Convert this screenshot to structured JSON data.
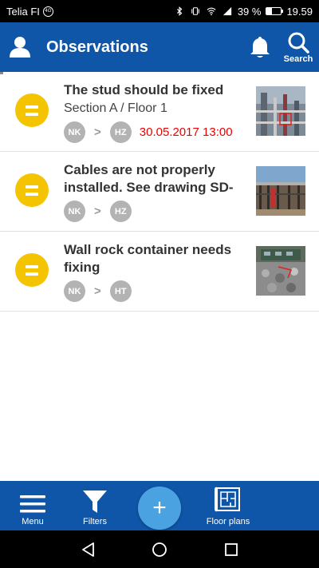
{
  "status_bar": {
    "carrier": "Telia FI",
    "carrier_badge": "4G",
    "battery": "39 %",
    "time": "19.59",
    "icons": [
      "bluetooth-icon",
      "vibrate-icon",
      "wifi-icon",
      "signal-icon",
      "battery-icon"
    ]
  },
  "header": {
    "title": "Observations",
    "search_label": "Search",
    "color": "#0f56a8",
    "icons": [
      "user-icon",
      "bell-icon",
      "search-icon"
    ]
  },
  "observations": [
    {
      "title": "The stud should be fixed",
      "subtitle": "Section A / Floor 1",
      "from": "NK",
      "to": "HZ",
      "date": "30.05.2017 13:00",
      "status_color": "#f5c400",
      "status_icon": "equals-icon"
    },
    {
      "title": "Cables are not properly installed. See drawing SD-",
      "subtitle": "",
      "from": "NK",
      "to": "HZ",
      "date": "",
      "status_color": "#f5c400",
      "status_icon": "equals-icon"
    },
    {
      "title": "Wall rock container needs fixing",
      "subtitle": "",
      "from": "NK",
      "to": "HT",
      "date": "",
      "status_color": "#f5c400",
      "status_icon": "equals-icon"
    }
  ],
  "bottom_nav": {
    "menu_label": "Menu",
    "filters_label": "Filters",
    "add_label": "+",
    "floorplans_label": "Floor plans",
    "fab_color": "#4aa3e0"
  },
  "android_nav": {
    "icons": [
      "back-icon",
      "home-icon",
      "recents-icon"
    ]
  }
}
